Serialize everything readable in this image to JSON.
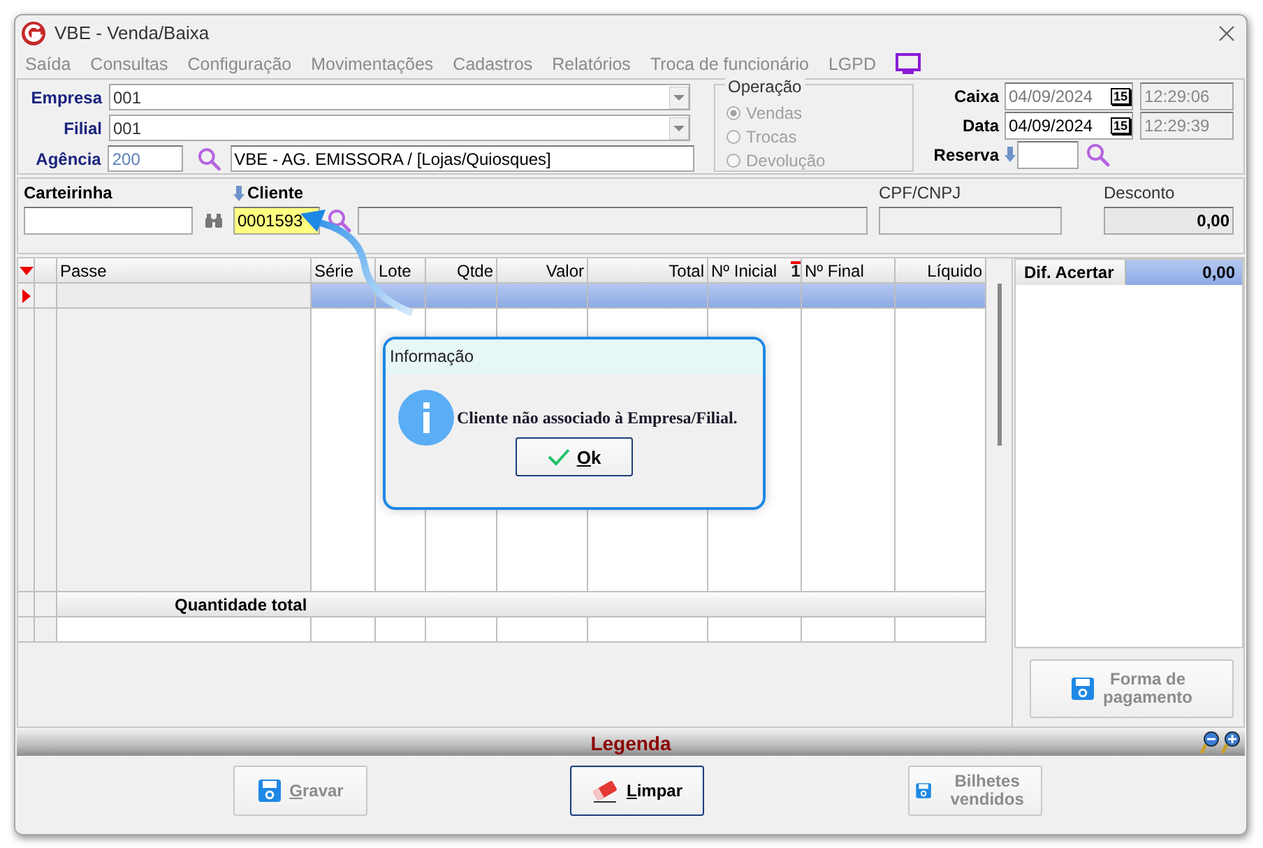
{
  "window": {
    "title": "VBE - Venda/Baixa"
  },
  "menu": [
    {
      "label": "Saída"
    },
    {
      "label": "Consultas"
    },
    {
      "label": "Configuração"
    },
    {
      "label": "Movimentações"
    },
    {
      "label": "Cadastros"
    },
    {
      "label": "Relatórios"
    },
    {
      "label": "Troca de funcionário"
    },
    {
      "label": "LGPD"
    }
  ],
  "header": {
    "empresa": {
      "label": "Empresa",
      "value": "001"
    },
    "filial": {
      "label": "Filial",
      "value": "001"
    },
    "agencia": {
      "label": "Agência",
      "code": "200",
      "description": "VBE - AG. EMISSORA / [Lojas/Quiosques]"
    }
  },
  "operacao": {
    "title": "Operação",
    "disabled": true,
    "options": [
      {
        "label": "Vendas",
        "selected": true
      },
      {
        "label": "Trocas",
        "selected": false
      },
      {
        "label": "Devolução",
        "selected": false
      }
    ]
  },
  "dates": [
    {
      "label": "Caixa",
      "date": "04/09/2024",
      "calendar": "15",
      "time": "12:29:06",
      "disabled": true
    },
    {
      "label": "Data",
      "date": "04/09/2024",
      "calendar": "15",
      "time": "12:29:39",
      "disabled": false
    }
  ],
  "reserva": {
    "label": "Reserva"
  },
  "customer": {
    "carteirinha": {
      "label": "Carteirinha"
    },
    "cliente": {
      "label": "Cliente",
      "code": "0001593"
    },
    "cpf": {
      "label": "CPF/CNPJ"
    },
    "desconto": {
      "label": "Desconto",
      "value": "0,00"
    }
  },
  "grid": {
    "columns": [
      {
        "label": "Passe"
      },
      {
        "label": "Série"
      },
      {
        "label": "Lote"
      },
      {
        "label": "Qtde"
      },
      {
        "label": "Valor"
      },
      {
        "label": "Total"
      },
      {
        "label": "Nº Inicial",
        "sort_mark": "1"
      },
      {
        "label": "Nº Final"
      },
      {
        "label": "Líquido"
      }
    ],
    "footer_label": "Quantidade total"
  },
  "summary": {
    "label": "Dif. Acertar",
    "value": "0,00"
  },
  "payment_button": {
    "label": "Forma de pagamento",
    "disabled": true
  },
  "legend": {
    "label": "Legenda"
  },
  "actions": [
    {
      "label": "Gravar",
      "mnemonic": true,
      "kind": "save",
      "disabled": true
    },
    {
      "label": "Limpar",
      "mnemonic": true,
      "kind": "eraser",
      "disabled": false
    },
    {
      "label": "Bilhetes vendidos",
      "mnemonic": false,
      "kind": "save",
      "disabled": true
    }
  ],
  "dialog": {
    "title": "Informação",
    "message": "Cliente não associado à Empresa/Filial.",
    "button": {
      "label": "Ok",
      "mnemonic": true
    }
  }
}
